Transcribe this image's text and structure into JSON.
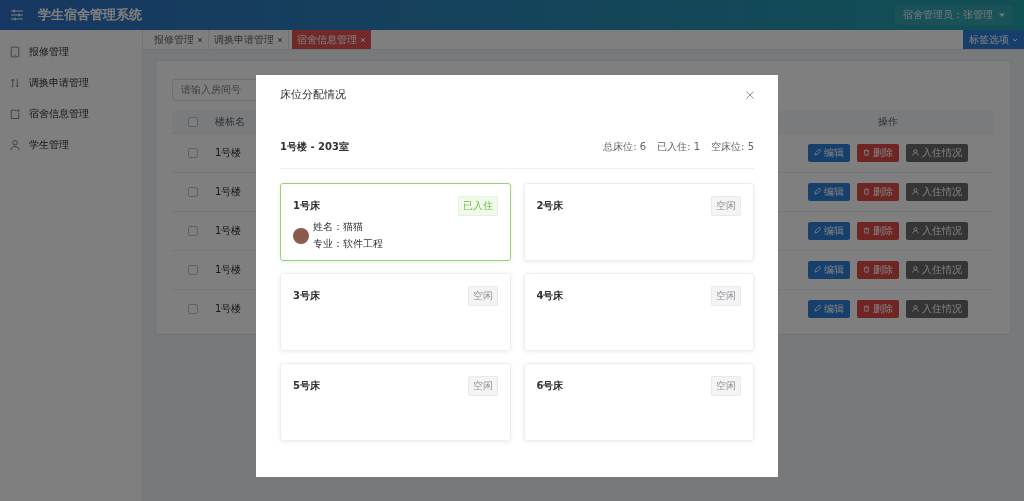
{
  "header": {
    "title": "学生宿舍管理系统",
    "user": "宿舍管理员：张管理"
  },
  "sidebar": {
    "items": [
      {
        "label": "报修管理"
      },
      {
        "label": "调换申请管理"
      },
      {
        "label": "宿舍信息管理"
      },
      {
        "label": "学生管理"
      }
    ]
  },
  "tabs": [
    {
      "label": "报修管理",
      "selected": false
    },
    {
      "label": "调换申请管理",
      "selected": false
    },
    {
      "label": "宿舍信息管理",
      "selected": true
    }
  ],
  "tab_options": "标签选项",
  "search": {
    "placeholder": "请输入房间号"
  },
  "table": {
    "select_all_checked": false,
    "columns": [
      "楼栋名",
      "操作"
    ],
    "rows": [
      {
        "checked": false,
        "column_1": "1号楼",
        "actions": [
          "编辑",
          "删除",
          "入住情况"
        ]
      },
      {
        "checked": false,
        "column_1": "1号楼",
        "actions": [
          "编辑",
          "删除",
          "入住情况"
        ]
      },
      {
        "checked": false,
        "column_1": "1号楼",
        "actions": [
          "编辑",
          "删除",
          "入住情况"
        ]
      },
      {
        "checked": false,
        "column_1": "1号楼",
        "actions": [
          "编辑",
          "删除",
          "入住情况"
        ]
      },
      {
        "checked": false,
        "column_1": "1号楼",
        "actions": [
          "编辑",
          "删除",
          "入住情况"
        ]
      }
    ]
  },
  "dialog": {
    "title": "床位分配情况",
    "room": "1号楼 - 203室",
    "stats": [
      "总床位: 6",
      "已入住: 1",
      "空床位: 5"
    ],
    "beds": [
      {
        "name": "1号床",
        "status": "已入住",
        "occupied": true,
        "student": {
          "name_label": "姓名：",
          "name": "猫猫",
          "major_label": "专业：",
          "major": "软件工程"
        }
      },
      {
        "name": "2号床",
        "status": "空闲",
        "occupied": false
      },
      {
        "name": "3号床",
        "status": "空闲",
        "occupied": false
      },
      {
        "name": "4号床",
        "status": "空闲",
        "occupied": false
      },
      {
        "name": "5号床",
        "status": "空闲",
        "occupied": false
      },
      {
        "name": "6号床",
        "status": "空闲",
        "occupied": false
      }
    ]
  }
}
